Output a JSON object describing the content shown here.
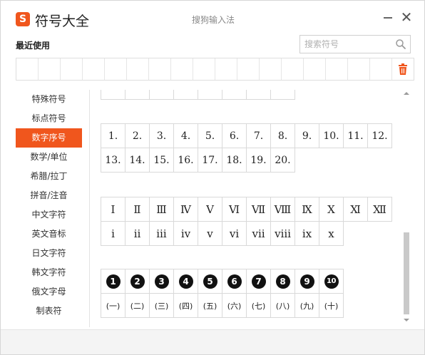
{
  "app": {
    "title": "符号大全",
    "window_title": "搜狗输入法",
    "logo_glyph": "S"
  },
  "recent": {
    "title": "最近使用",
    "cell_count": 18
  },
  "search": {
    "placeholder": "搜索符号",
    "value": ""
  },
  "categories": [
    {
      "label": "特殊符号",
      "active": false
    },
    {
      "label": "标点符号",
      "active": false
    },
    {
      "label": "数字序号",
      "active": true
    },
    {
      "label": "数学/单位",
      "active": false
    },
    {
      "label": "希腊/拉丁",
      "active": false
    },
    {
      "label": "拼音/注音",
      "active": false
    },
    {
      "label": "中文字符",
      "active": false
    },
    {
      "label": "英文音标",
      "active": false
    },
    {
      "label": "日文字符",
      "active": false
    },
    {
      "label": "韩文字符",
      "active": false
    },
    {
      "label": "俄文字母",
      "active": false
    },
    {
      "label": "制表符",
      "active": false
    }
  ],
  "numbered": {
    "row1": [
      "1.",
      "2.",
      "3.",
      "4.",
      "5.",
      "6.",
      "7.",
      "8.",
      "9.",
      "10.",
      "11.",
      "12."
    ],
    "row2": [
      "13.",
      "14.",
      "15.",
      "16.",
      "17.",
      "18.",
      "19.",
      "20."
    ]
  },
  "roman": {
    "upper": [
      "Ⅰ",
      "Ⅱ",
      "Ⅲ",
      "Ⅳ",
      "Ⅴ",
      "Ⅵ",
      "Ⅶ",
      "Ⅷ",
      "Ⅸ",
      "Ⅹ",
      "Ⅺ",
      "Ⅻ"
    ],
    "lower": [
      "ⅰ",
      "ⅱ",
      "ⅲ",
      "ⅳ",
      "ⅴ",
      "ⅵ",
      "ⅶ",
      "ⅷ",
      "ⅸ",
      "ⅹ"
    ]
  },
  "circled": {
    "numbers": [
      "1",
      "2",
      "3",
      "4",
      "5",
      "6",
      "7",
      "8",
      "9",
      "10"
    ],
    "parenthesized": [
      "(一)",
      "(二)",
      "(三)",
      "(四)",
      "(五)",
      "(六)",
      "(七)",
      "(八)",
      "(九)",
      "(十)"
    ]
  },
  "colors": {
    "accent": "#f0561d",
    "border": "#d9d9d9",
    "scroll_thumb": "#c9c9c9"
  },
  "icons": [
    "sogou-logo-icon",
    "minimize-icon",
    "close-icon",
    "search-icon",
    "trash-icon",
    "scroll-up-icon",
    "scroll-down-icon"
  ]
}
